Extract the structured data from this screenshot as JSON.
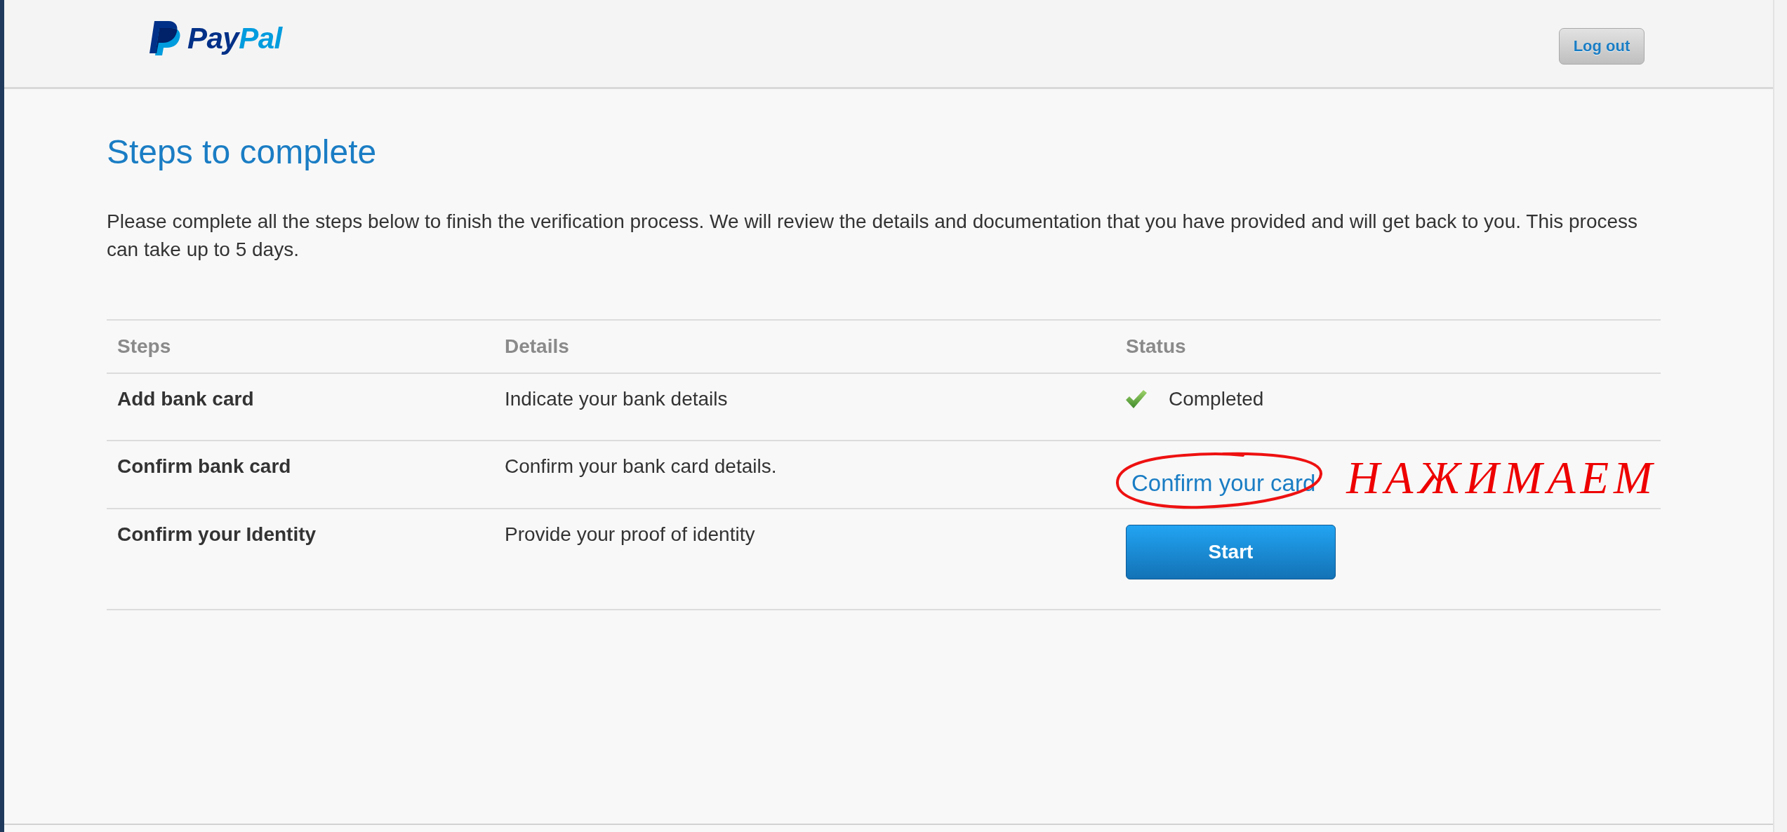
{
  "header": {
    "logo": {
      "parts": [
        "Pay",
        "Pal"
      ]
    },
    "logout_button": "Log out"
  },
  "title": "Steps to complete",
  "intro": "Please complete all the steps below to finish the verification process. We will review the details and documentation that you have provided and will get back to you. This process can take up to 5 days.",
  "table": {
    "columns": [
      "Steps",
      "Details",
      "Status"
    ],
    "rows": [
      {
        "step": "Add bank card",
        "details": "Indicate your bank details",
        "status": {
          "kind": "completed",
          "text": "Completed"
        }
      },
      {
        "step": "Confirm bank card",
        "details": "Confirm your bank card details.",
        "status": {
          "kind": "link",
          "text": "Confirm your card"
        },
        "annotation": {
          "circled": true,
          "text": "НАЖИМАЕМ"
        }
      },
      {
        "step": "Confirm your Identity",
        "details": "Provide your proof of identity",
        "status": {
          "kind": "button",
          "text": "Start"
        }
      }
    ]
  }
}
